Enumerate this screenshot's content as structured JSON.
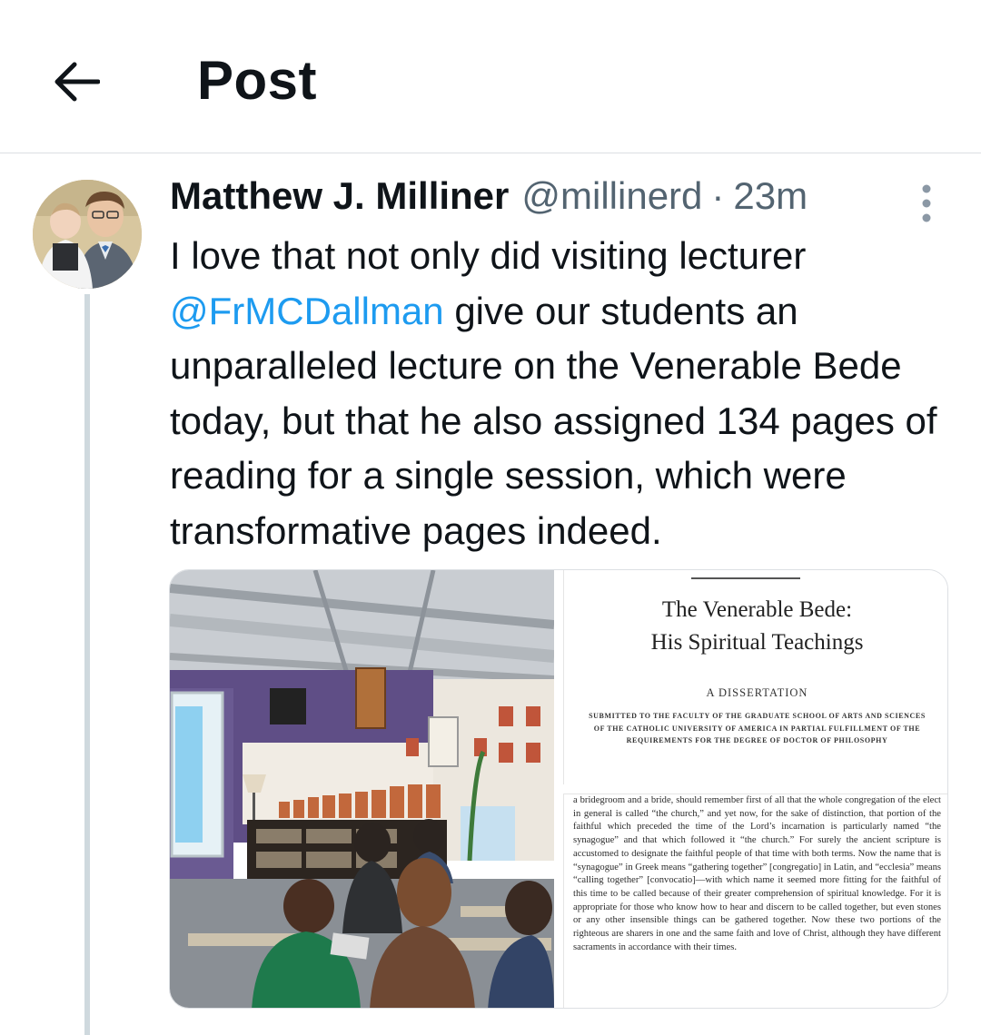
{
  "header": {
    "title": "Post",
    "back_icon": "arrow-left-icon"
  },
  "post": {
    "author_name": "Matthew J. Milliner",
    "handle": "@millinerd",
    "separator": "·",
    "time": "23m",
    "text_before_mention": "I love that not only did visiting lecturer",
    "mention": "@FrMCDallman",
    "text_after_mention": "give our students an unparalleled lecture on the Venerable Bede today, but that he also assigned 134 pages of reading for a single session, which were transformative pages indeed.",
    "more_icon": "more-vertical-icon"
  },
  "media": {
    "document_title_line1": "The Venerable Bede:",
    "document_title_line2": "His Spiritual Teachings",
    "document_subtitle": "A DISSERTATION",
    "document_submission": "SUBMITTED TO THE FACULTY OF THE GRADUATE SCHOOL OF ARTS AND SCIENCES OF THE CATHOLIC UNIVERSITY OF AMERICA IN PARTIAL FULFILLMENT OF THE REQUIREMENTS FOR THE DEGREE OF DOCTOR OF PHILOSOPHY",
    "page_excerpt": "a bridegroom and a bride, should remember first of all that the whole congregation of the elect in general is called “the church,” and yet now, for the sake of distinction, that portion of the faithful which preceded the time of the Lord’s incarnation is particularly named “the synagogue” and that which followed it “the church.” For surely the ancient scripture is accustomed to designate the faithful people of that time with both terms. Now the name that is “synagogue” in Greek means “gathering together” [congregatio] in Latin, and “ecclesia” means “calling together” [convocatio]—with which name it seemed more fitting for the faithful of this time to be called because of their greater comprehension of spiritual knowledge. For it is appropriate for those who know how to hear and discern to be called together, but even stones or any other insensible things can be gathered together. Now these two portions of the righteous are sharers in one and the same faith and love of Christ, although they have different sacraments in accordance with their times."
  }
}
